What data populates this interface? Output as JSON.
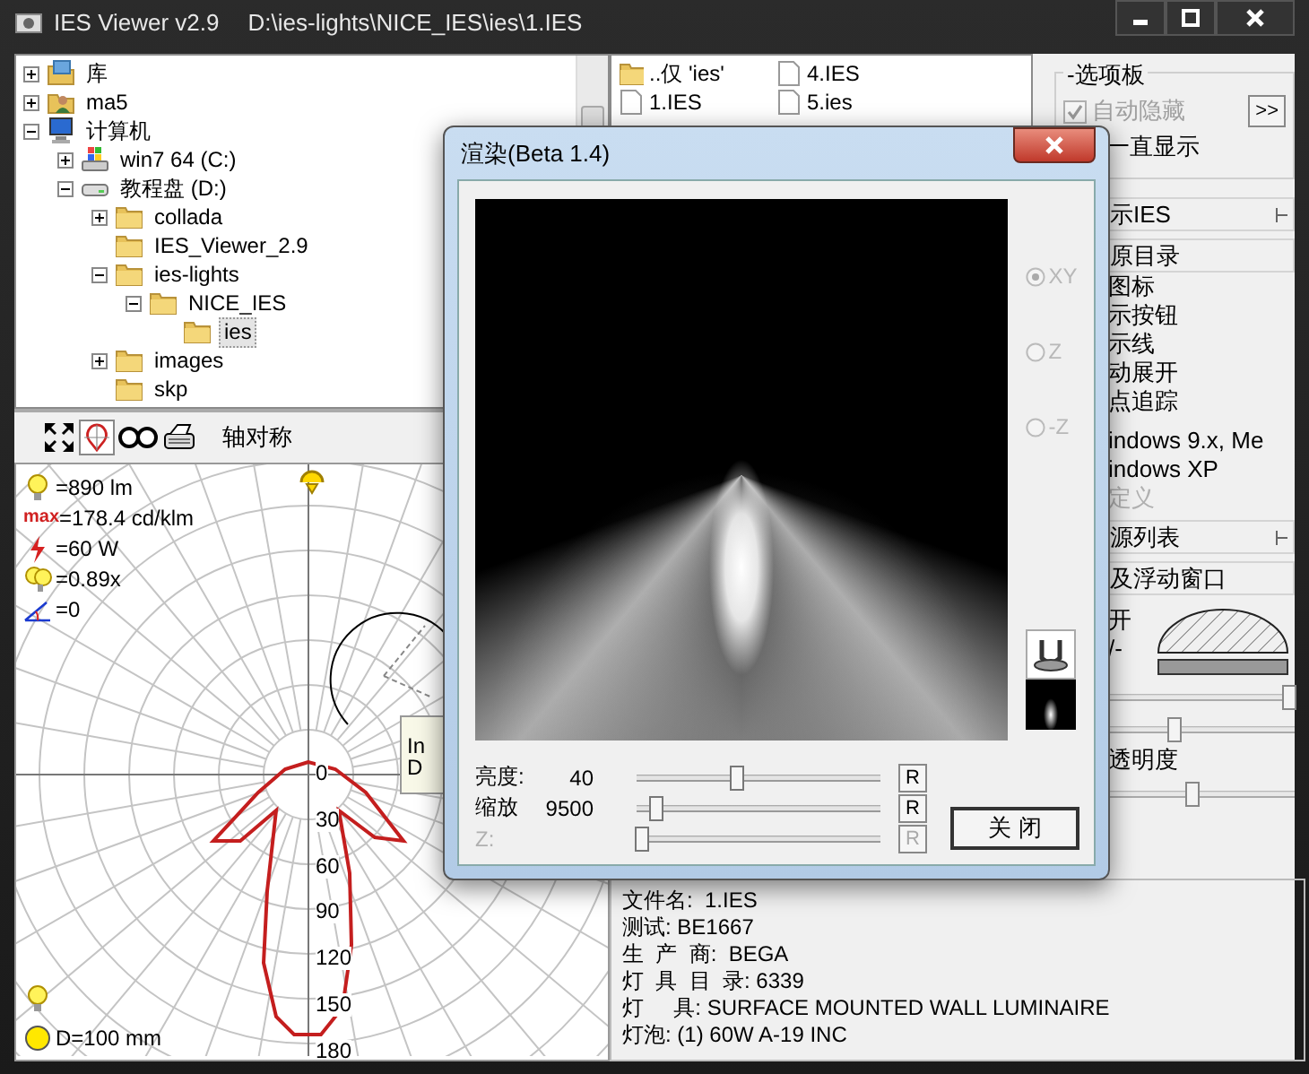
{
  "window": {
    "title": "IES Viewer v2.9",
    "path": "D:\\ies-lights\\NICE_IES\\ies\\1.IES"
  },
  "folder_tree": [
    {
      "label": "库",
      "kind": "library",
      "expanded": false,
      "selected": false
    },
    {
      "label": "ma5",
      "kind": "user",
      "expanded": false,
      "selected": false
    },
    {
      "label": "计算机",
      "kind": "computer",
      "expanded": true,
      "selected": false,
      "children": [
        {
          "label": "win7 64 (C:)",
          "kind": "system-drive",
          "expanded": false,
          "selected": false
        },
        {
          "label": "教程盘 (D:)",
          "kind": "drive",
          "expanded": true,
          "selected": false,
          "children": [
            {
              "label": "collada",
              "kind": "folder",
              "expanded": false,
              "selected": false
            },
            {
              "label": "IES_Viewer_2.9",
              "kind": "folder",
              "selected": false
            },
            {
              "label": "ies-lights",
              "kind": "folder",
              "expanded": true,
              "selected": false,
              "children": [
                {
                  "label": "NICE_IES",
                  "kind": "folder",
                  "expanded": true,
                  "selected": false,
                  "children": [
                    {
                      "label": "ies",
                      "kind": "folder",
                      "selected": true
                    }
                  ]
                }
              ]
            },
            {
              "label": "images",
              "kind": "folder",
              "expanded": false,
              "selected": false
            },
            {
              "label": "skp",
              "kind": "folder",
              "selected": false
            }
          ]
        }
      ]
    }
  ],
  "file_list": [
    {
      "label": "..仅 'ies'",
      "kind": "folder"
    },
    {
      "label": "1.IES",
      "kind": "file"
    },
    {
      "label": "4.IES",
      "kind": "file"
    },
    {
      "label": "5.ies",
      "kind": "file"
    }
  ],
  "options_panel": {
    "title": "-选项板",
    "auto_hide": {
      "label": "自动隐藏",
      "checked": true,
      "disabled": true
    },
    "expand_button": ">>",
    "always_show": "一直显示",
    "items": [
      {
        "kind": "header",
        "label": "示IES",
        "pin": true
      },
      {
        "kind": "header",
        "label": "原目录",
        "pin": false
      },
      {
        "kind": "text",
        "label": "图标",
        "disabled": false
      },
      {
        "kind": "text",
        "label": "示按钮",
        "disabled": false
      },
      {
        "kind": "text",
        "label": "示线",
        "disabled": false
      },
      {
        "kind": "text",
        "label": "动展开",
        "disabled": false
      },
      {
        "kind": "text",
        "label": "点追踪",
        "disabled": false
      },
      {
        "kind": "gap"
      },
      {
        "kind": "text",
        "label": "indows 9.x, Me",
        "disabled": false
      },
      {
        "kind": "text",
        "label": "indows XP",
        "disabled": false
      },
      {
        "kind": "text",
        "label": "定义",
        "disabled": true
      },
      {
        "kind": "header",
        "label": "源列表",
        "pin": true
      },
      {
        "kind": "header",
        "label": "及浮动窗口",
        "pin": false
      },
      {
        "kind": "dome",
        "labels": [
          "开",
          "/-"
        ]
      },
      {
        "kind": "slider",
        "level": 0.97
      },
      {
        "kind": "slider",
        "level": 0.36
      },
      {
        "kind": "text",
        "label": "透明度",
        "disabled": false
      },
      {
        "kind": "slider",
        "level": 0.45
      }
    ]
  },
  "polar_panel": {
    "mode_label": "轴对称",
    "legend": [
      {
        "kind": "flux",
        "text": "=890 lm"
      },
      {
        "kind": "max",
        "icon_text": "max",
        "text": "=178.4 cd/klm"
      },
      {
        "kind": "power",
        "text": "=60 W"
      },
      {
        "kind": "factor",
        "text": "=0.89x"
      },
      {
        "kind": "tilt",
        "text": "=0"
      }
    ],
    "angle_labels": [
      "0",
      "30",
      "60",
      "90",
      "120",
      "150",
      "180"
    ],
    "tooltip": [
      "In",
      "D"
    ],
    "diameter": "D=100 mm"
  },
  "info": [
    "文件名:  1.IES",
    "测试: BE1667",
    "生  产  商:  BEGA",
    "灯  具  目  录: 6339",
    "灯     具: SURFACE MOUNTED WALL LUMINAIRE",
    "灯泡: (1) 60W A-19 INC"
  ],
  "render_dialog": {
    "title": "渲染(Beta 1.4)",
    "view_modes": [
      {
        "label": "XY",
        "selected": true,
        "disabled": true
      },
      {
        "label": "Z",
        "selected": false,
        "disabled": true
      },
      {
        "label": "-Z",
        "selected": false,
        "disabled": true
      }
    ],
    "sliders": [
      {
        "label": "亮度:",
        "value": "40",
        "level": 0.41,
        "reset": "R",
        "disabled": false
      },
      {
        "label": "缩放",
        "value": "9500",
        "level": 0.08,
        "reset": "R",
        "disabled": false
      },
      {
        "label": "Z:",
        "level": 0.02,
        "reset": "R",
        "disabled": true
      }
    ],
    "close_button": "关 闭"
  }
}
